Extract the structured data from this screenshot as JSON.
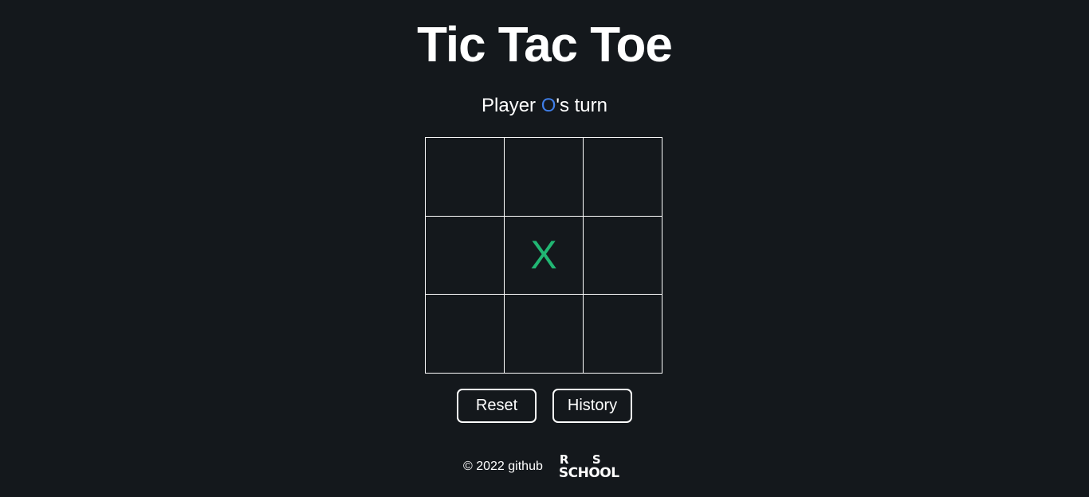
{
  "header": {
    "title": "Tic Tac Toe"
  },
  "status": {
    "prefix": "Player ",
    "player": "O",
    "suffix": "'s turn"
  },
  "board": {
    "cells": [
      "",
      "",
      "",
      "",
      "X",
      "",
      "",
      "",
      ""
    ]
  },
  "buttons": {
    "reset_label": "Reset",
    "history_label": "History"
  },
  "footer": {
    "copyright": "© 2022 github",
    "logo": {
      "line1_left": "R",
      "line1_right": "S",
      "line2": "SCHOOL"
    }
  },
  "colors": {
    "background": "#14181c",
    "x_color": "#21b673",
    "o_color": "#3f7ee8"
  }
}
